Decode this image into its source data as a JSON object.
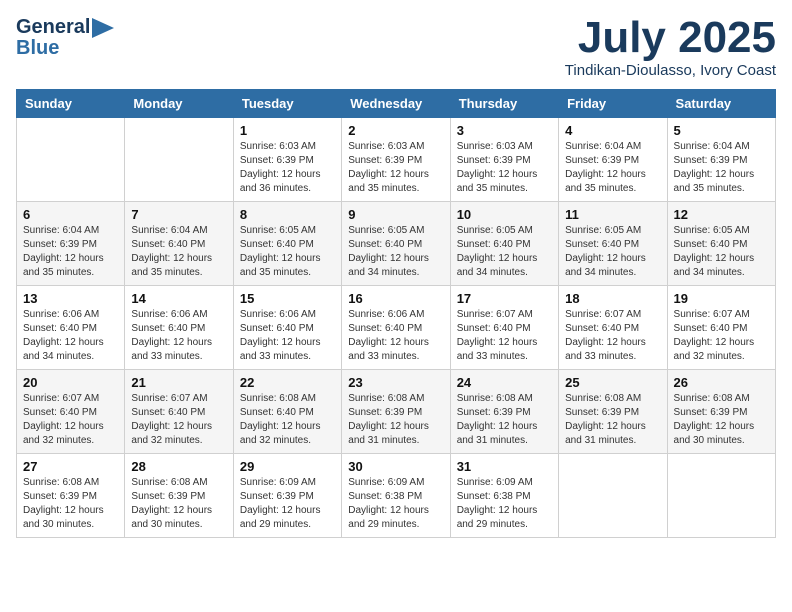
{
  "header": {
    "logo_general": "General",
    "logo_blue": "Blue",
    "month_title": "July 2025",
    "location": "Tindikan-Dioulasso, Ivory Coast"
  },
  "weekdays": [
    "Sunday",
    "Monday",
    "Tuesday",
    "Wednesday",
    "Thursday",
    "Friday",
    "Saturday"
  ],
  "weeks": [
    [
      {
        "day": "",
        "sunrise": "",
        "sunset": "",
        "daylight": ""
      },
      {
        "day": "",
        "sunrise": "",
        "sunset": "",
        "daylight": ""
      },
      {
        "day": "1",
        "sunrise": "Sunrise: 6:03 AM",
        "sunset": "Sunset: 6:39 PM",
        "daylight": "Daylight: 12 hours and 36 minutes."
      },
      {
        "day": "2",
        "sunrise": "Sunrise: 6:03 AM",
        "sunset": "Sunset: 6:39 PM",
        "daylight": "Daylight: 12 hours and 35 minutes."
      },
      {
        "day": "3",
        "sunrise": "Sunrise: 6:03 AM",
        "sunset": "Sunset: 6:39 PM",
        "daylight": "Daylight: 12 hours and 35 minutes."
      },
      {
        "day": "4",
        "sunrise": "Sunrise: 6:04 AM",
        "sunset": "Sunset: 6:39 PM",
        "daylight": "Daylight: 12 hours and 35 minutes."
      },
      {
        "day": "5",
        "sunrise": "Sunrise: 6:04 AM",
        "sunset": "Sunset: 6:39 PM",
        "daylight": "Daylight: 12 hours and 35 minutes."
      }
    ],
    [
      {
        "day": "6",
        "sunrise": "Sunrise: 6:04 AM",
        "sunset": "Sunset: 6:39 PM",
        "daylight": "Daylight: 12 hours and 35 minutes."
      },
      {
        "day": "7",
        "sunrise": "Sunrise: 6:04 AM",
        "sunset": "Sunset: 6:40 PM",
        "daylight": "Daylight: 12 hours and 35 minutes."
      },
      {
        "day": "8",
        "sunrise": "Sunrise: 6:05 AM",
        "sunset": "Sunset: 6:40 PM",
        "daylight": "Daylight: 12 hours and 35 minutes."
      },
      {
        "day": "9",
        "sunrise": "Sunrise: 6:05 AM",
        "sunset": "Sunset: 6:40 PM",
        "daylight": "Daylight: 12 hours and 34 minutes."
      },
      {
        "day": "10",
        "sunrise": "Sunrise: 6:05 AM",
        "sunset": "Sunset: 6:40 PM",
        "daylight": "Daylight: 12 hours and 34 minutes."
      },
      {
        "day": "11",
        "sunrise": "Sunrise: 6:05 AM",
        "sunset": "Sunset: 6:40 PM",
        "daylight": "Daylight: 12 hours and 34 minutes."
      },
      {
        "day": "12",
        "sunrise": "Sunrise: 6:05 AM",
        "sunset": "Sunset: 6:40 PM",
        "daylight": "Daylight: 12 hours and 34 minutes."
      }
    ],
    [
      {
        "day": "13",
        "sunrise": "Sunrise: 6:06 AM",
        "sunset": "Sunset: 6:40 PM",
        "daylight": "Daylight: 12 hours and 34 minutes."
      },
      {
        "day": "14",
        "sunrise": "Sunrise: 6:06 AM",
        "sunset": "Sunset: 6:40 PM",
        "daylight": "Daylight: 12 hours and 33 minutes."
      },
      {
        "day": "15",
        "sunrise": "Sunrise: 6:06 AM",
        "sunset": "Sunset: 6:40 PM",
        "daylight": "Daylight: 12 hours and 33 minutes."
      },
      {
        "day": "16",
        "sunrise": "Sunrise: 6:06 AM",
        "sunset": "Sunset: 6:40 PM",
        "daylight": "Daylight: 12 hours and 33 minutes."
      },
      {
        "day": "17",
        "sunrise": "Sunrise: 6:07 AM",
        "sunset": "Sunset: 6:40 PM",
        "daylight": "Daylight: 12 hours and 33 minutes."
      },
      {
        "day": "18",
        "sunrise": "Sunrise: 6:07 AM",
        "sunset": "Sunset: 6:40 PM",
        "daylight": "Daylight: 12 hours and 33 minutes."
      },
      {
        "day": "19",
        "sunrise": "Sunrise: 6:07 AM",
        "sunset": "Sunset: 6:40 PM",
        "daylight": "Daylight: 12 hours and 32 minutes."
      }
    ],
    [
      {
        "day": "20",
        "sunrise": "Sunrise: 6:07 AM",
        "sunset": "Sunset: 6:40 PM",
        "daylight": "Daylight: 12 hours and 32 minutes."
      },
      {
        "day": "21",
        "sunrise": "Sunrise: 6:07 AM",
        "sunset": "Sunset: 6:40 PM",
        "daylight": "Daylight: 12 hours and 32 minutes."
      },
      {
        "day": "22",
        "sunrise": "Sunrise: 6:08 AM",
        "sunset": "Sunset: 6:40 PM",
        "daylight": "Daylight: 12 hours and 32 minutes."
      },
      {
        "day": "23",
        "sunrise": "Sunrise: 6:08 AM",
        "sunset": "Sunset: 6:39 PM",
        "daylight": "Daylight: 12 hours and 31 minutes."
      },
      {
        "day": "24",
        "sunrise": "Sunrise: 6:08 AM",
        "sunset": "Sunset: 6:39 PM",
        "daylight": "Daylight: 12 hours and 31 minutes."
      },
      {
        "day": "25",
        "sunrise": "Sunrise: 6:08 AM",
        "sunset": "Sunset: 6:39 PM",
        "daylight": "Daylight: 12 hours and 31 minutes."
      },
      {
        "day": "26",
        "sunrise": "Sunrise: 6:08 AM",
        "sunset": "Sunset: 6:39 PM",
        "daylight": "Daylight: 12 hours and 30 minutes."
      }
    ],
    [
      {
        "day": "27",
        "sunrise": "Sunrise: 6:08 AM",
        "sunset": "Sunset: 6:39 PM",
        "daylight": "Daylight: 12 hours and 30 minutes."
      },
      {
        "day": "28",
        "sunrise": "Sunrise: 6:08 AM",
        "sunset": "Sunset: 6:39 PM",
        "daylight": "Daylight: 12 hours and 30 minutes."
      },
      {
        "day": "29",
        "sunrise": "Sunrise: 6:09 AM",
        "sunset": "Sunset: 6:39 PM",
        "daylight": "Daylight: 12 hours and 29 minutes."
      },
      {
        "day": "30",
        "sunrise": "Sunrise: 6:09 AM",
        "sunset": "Sunset: 6:38 PM",
        "daylight": "Daylight: 12 hours and 29 minutes."
      },
      {
        "day": "31",
        "sunrise": "Sunrise: 6:09 AM",
        "sunset": "Sunset: 6:38 PM",
        "daylight": "Daylight: 12 hours and 29 minutes."
      },
      {
        "day": "",
        "sunrise": "",
        "sunset": "",
        "daylight": ""
      },
      {
        "day": "",
        "sunrise": "",
        "sunset": "",
        "daylight": ""
      }
    ]
  ]
}
